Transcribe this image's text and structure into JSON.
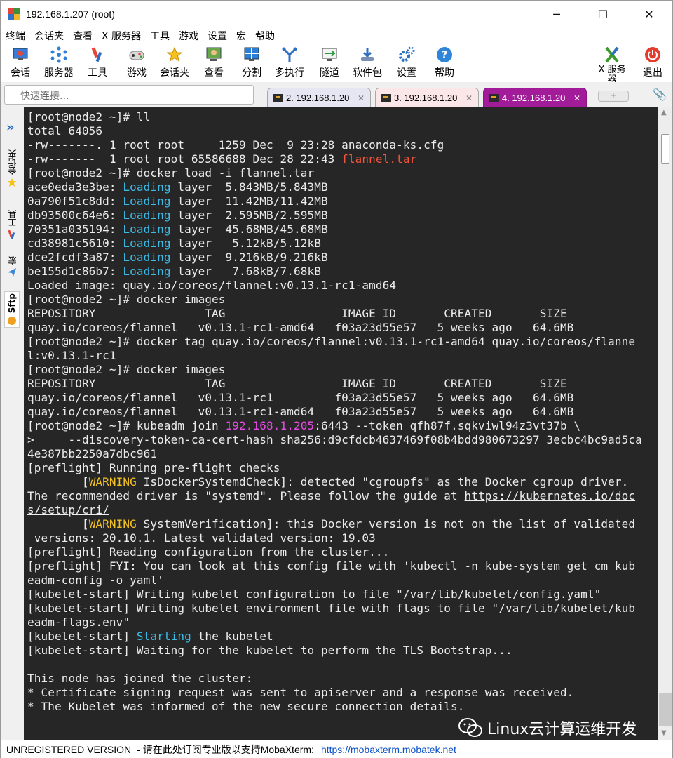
{
  "window": {
    "title": "192.168.1.207 (root)",
    "minimize": "─",
    "maximize": "☐",
    "close": "✕"
  },
  "menu": [
    "终端",
    "会话夹",
    "查看",
    "X 服务器",
    "工具",
    "游戏",
    "设置",
    "宏",
    "帮助"
  ],
  "toolbar": [
    {
      "label": "会话",
      "icon": "session-icon"
    },
    {
      "label": "服务器",
      "icon": "servers-icon"
    },
    {
      "label": "工具",
      "icon": "tools-icon"
    },
    {
      "label": "游戏",
      "icon": "games-icon"
    },
    {
      "label": "会话夹",
      "icon": "star-icon"
    },
    {
      "label": "查看",
      "icon": "view-icon"
    },
    {
      "label": "分割",
      "icon": "split-icon"
    },
    {
      "label": "多执行",
      "icon": "multiexec-icon"
    },
    {
      "label": "隧道",
      "icon": "tunnel-icon"
    },
    {
      "label": "软件包",
      "icon": "packages-icon"
    },
    {
      "label": "设置",
      "icon": "settings-icon"
    },
    {
      "label": "帮助",
      "icon": "help-icon"
    }
  ],
  "toolbar_right": {
    "xserver_label": "X 服务器",
    "exit_label": "退出"
  },
  "quick_connect": {
    "placeholder": "快速连接..."
  },
  "tabs": [
    {
      "label": "2. 192.168.1.20",
      "close": "✕",
      "active": false
    },
    {
      "label": "3. 192.168.1.20",
      "close": "✕",
      "active": false
    },
    {
      "label": "4. 192.168.1.20",
      "close": "✕",
      "active": true
    }
  ],
  "sidebar": {
    "arrow": "»",
    "tabs": [
      "会话夹",
      "工具",
      "宏",
      "Sftp"
    ]
  },
  "terminal": {
    "lines": [
      [
        {
          "t": "[root@node2 ~]# ll"
        }
      ],
      [
        {
          "t": "total 64056"
        }
      ],
      [
        {
          "t": "-rw-------. 1 root root     1259 Dec  9 23:28 anaconda-ks.cfg"
        }
      ],
      [
        {
          "t": "-rw-------  1 root root 65586688 Dec 28 22:43 "
        },
        {
          "t": "flannel.tar",
          "c": "red"
        }
      ],
      [
        {
          "t": "[root@node2 ~]# docker load -i flannel.tar"
        }
      ],
      [
        {
          "t": "ace0eda3e3be: "
        },
        {
          "t": "Loading",
          "c": "cyan"
        },
        {
          "t": " layer  5.843MB/5.843MB"
        }
      ],
      [
        {
          "t": "0a790f51c8dd: "
        },
        {
          "t": "Loading",
          "c": "cyan"
        },
        {
          "t": " layer  11.42MB/11.42MB"
        }
      ],
      [
        {
          "t": "db93500c64e6: "
        },
        {
          "t": "Loading",
          "c": "cyan"
        },
        {
          "t": " layer  2.595MB/2.595MB"
        }
      ],
      [
        {
          "t": "70351a035194: "
        },
        {
          "t": "Loading",
          "c": "cyan"
        },
        {
          "t": " layer  45.68MB/45.68MB"
        }
      ],
      [
        {
          "t": "cd38981c5610: "
        },
        {
          "t": "Loading",
          "c": "cyan"
        },
        {
          "t": " layer   5.12kB/5.12kB"
        }
      ],
      [
        {
          "t": "dce2fcdf3a87: "
        },
        {
          "t": "Loading",
          "c": "cyan"
        },
        {
          "t": " layer  9.216kB/9.216kB"
        }
      ],
      [
        {
          "t": "be155d1c86b7: "
        },
        {
          "t": "Loading",
          "c": "cyan"
        },
        {
          "t": " layer   7.68kB/7.68kB"
        }
      ],
      [
        {
          "t": "Loaded image: quay.io/coreos/flannel:v0.13.1-rc1-amd64"
        }
      ],
      [
        {
          "t": "[root@node2 ~]# docker images"
        }
      ],
      [
        {
          "t": "REPOSITORY                TAG                 IMAGE ID       CREATED       SIZE"
        }
      ],
      [
        {
          "t": "quay.io/coreos/flannel   v0.13.1-rc1-amd64   f03a23d55e57   5 weeks ago   64.6MB"
        }
      ],
      [
        {
          "t": "[root@node2 ~]# docker tag quay.io/coreos/flannel:v0.13.1-rc1-amd64 quay.io/coreos/flanne"
        }
      ],
      [
        {
          "t": "l:v0.13.1-rc1"
        }
      ],
      [
        {
          "t": "[root@node2 ~]# docker images"
        }
      ],
      [
        {
          "t": "REPOSITORY                TAG                 IMAGE ID       CREATED       SIZE"
        }
      ],
      [
        {
          "t": "quay.io/coreos/flannel   v0.13.1-rc1         f03a23d55e57   5 weeks ago   64.6MB"
        }
      ],
      [
        {
          "t": "quay.io/coreos/flannel   v0.13.1-rc1-amd64   f03a23d55e57   5 weeks ago   64.6MB"
        }
      ],
      [
        {
          "t": "[root@node2 ~]# kubeadm join "
        },
        {
          "t": "192.168.1.205",
          "c": "mag"
        },
        {
          "t": ":6443 --token qfh87f.sqkviwl94z3vt37b \\"
        }
      ],
      [
        {
          "t": ">     --discovery-token-ca-cert-hash sha256:d9cfdcb4637469f08b4bdd980673297 3ecbc4bc9ad5ca"
        }
      ],
      [
        {
          "t": "4e387bb2250a7dbc961"
        }
      ],
      [
        {
          "t": "[preflight] Running pre-flight checks"
        }
      ],
      [
        {
          "t": "        ["
        },
        {
          "t": "WARNING",
          "c": "yel"
        },
        {
          "t": " IsDockerSystemdCheck]: detected \"cgroupfs\" as the Docker cgroup driver."
        }
      ],
      [
        {
          "t": "The recommended driver is \"systemd\". Please follow the guide at "
        },
        {
          "t": "https://kubernetes.io/doc",
          "c": "url"
        }
      ],
      [
        {
          "t": "s/setup/cri/",
          "c": "url"
        }
      ],
      [
        {
          "t": "        ["
        },
        {
          "t": "WARNING",
          "c": "yel"
        },
        {
          "t": " SystemVerification]: this Docker version is not on the list of validated"
        }
      ],
      [
        {
          "t": " versions: 20.10.1. Latest validated version: 19.03"
        }
      ],
      [
        {
          "t": "[preflight] Reading configuration from the cluster..."
        }
      ],
      [
        {
          "t": "[preflight] FYI: You can look at this config file with 'kubectl -n kube-system get cm kub"
        }
      ],
      [
        {
          "t": "eadm-config -o yaml'"
        }
      ],
      [
        {
          "t": "[kubelet-start] Writing kubelet configuration to file \"/var/lib/kubelet/config.yaml\""
        }
      ],
      [
        {
          "t": "[kubelet-start] Writing kubelet environment file with flags to file \"/var/lib/kubelet/kub"
        }
      ],
      [
        {
          "t": "eadm-flags.env\""
        }
      ],
      [
        {
          "t": "[kubelet-start] "
        },
        {
          "t": "Starting",
          "c": "cyan"
        },
        {
          "t": " the kubelet"
        }
      ],
      [
        {
          "t": "[kubelet-start] Waiting for the kubelet to perform the TLS Bootstrap..."
        }
      ],
      [
        {
          "t": ""
        }
      ],
      [
        {
          "t": "This node has joined the cluster:"
        }
      ],
      [
        {
          "t": "* Certificate signing request was sent to apiserver and a response was received."
        }
      ],
      [
        {
          "t": "* The Kubelet was informed of the new secure connection details."
        }
      ]
    ]
  },
  "watermark": {
    "text": "Linux云计算运维开发"
  },
  "status": {
    "unregistered": "UNREGISTERED VERSION",
    "message": "-  请在此处订阅专业版以支持MobaXterm:",
    "link": "https://mobaxterm.mobatek.net"
  },
  "colors": {
    "terminal_bg": "#262626",
    "cyan": "#3dbbe6",
    "red": "#f2553b",
    "magenta": "#e64de6",
    "yellow": "#f2c224",
    "active_tab": "#a21c9a"
  }
}
